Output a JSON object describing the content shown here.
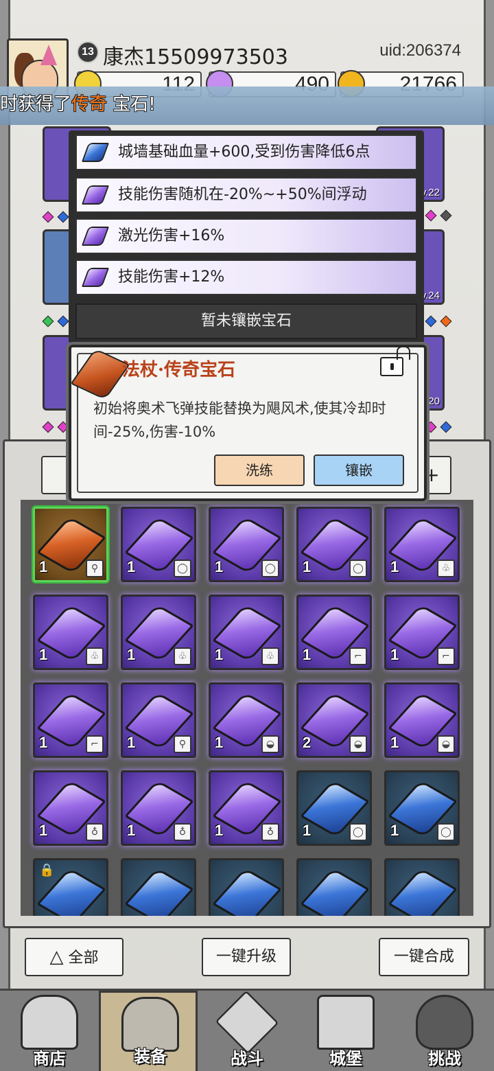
{
  "player": {
    "level": "13",
    "name": "康杰15509973503",
    "uid": "uid:206374"
  },
  "currencies": {
    "gold_bars": "112",
    "gems": "490",
    "coins": "21766"
  },
  "banner": {
    "prefix": "时获得了",
    "highlight": "传奇",
    "suffix": "宝石!"
  },
  "equip_slots": {
    "lv_a": "Lv.22",
    "lv_b": "Lv.24",
    "lv_c": "Lv.20"
  },
  "attributes": [
    {
      "text": "城墙基础血量+600,受到伤害降低6点",
      "gem": "blue"
    },
    {
      "text": "技能伤害随机在-20%~+50%间浮动",
      "gem": "purple"
    },
    {
      "text": "激光伤害+16%",
      "gem": "purple"
    },
    {
      "text": "技能伤害+12%",
      "gem": "purple"
    }
  ],
  "empty_socket": "暂未镶嵌宝石",
  "popup": {
    "title": "法杖·传奇宝石",
    "description": "初始将奥术飞弹技能替换为飓风术,使其冷却时间-25%,伤害-10%",
    "refine_button": "洗练",
    "inlay_button": "镶嵌"
  },
  "inventory": {
    "tab_right_label": "+",
    "rows": [
      [
        {
          "rarity": "legend",
          "qty": "1",
          "type": "staff"
        },
        {
          "rarity": "epic",
          "qty": "1",
          "type": "ring"
        },
        {
          "rarity": "epic",
          "qty": "1",
          "type": "ring"
        },
        {
          "rarity": "epic",
          "qty": "1",
          "type": "ring"
        },
        {
          "rarity": "epic",
          "qty": "1",
          "type": "armor"
        }
      ],
      [
        {
          "rarity": "epic",
          "qty": "1",
          "type": "armor"
        },
        {
          "rarity": "epic",
          "qty": "1",
          "type": "armor"
        },
        {
          "rarity": "epic",
          "qty": "1",
          "type": "armor"
        },
        {
          "rarity": "epic",
          "qty": "1",
          "type": "boots"
        },
        {
          "rarity": "epic",
          "qty": "1",
          "type": "boots"
        }
      ],
      [
        {
          "rarity": "epic",
          "qty": "1",
          "type": "boots"
        },
        {
          "rarity": "epic",
          "qty": "1",
          "type": "staff"
        },
        {
          "rarity": "epic",
          "qty": "1",
          "type": "hat"
        },
        {
          "rarity": "epic",
          "qty": "2",
          "type": "hat"
        },
        {
          "rarity": "epic",
          "qty": "1",
          "type": "hat"
        }
      ],
      [
        {
          "rarity": "epic",
          "qty": "1",
          "type": "necklace"
        },
        {
          "rarity": "epic",
          "qty": "1",
          "type": "necklace"
        },
        {
          "rarity": "epic",
          "qty": "1",
          "type": "necklace"
        },
        {
          "rarity": "rare",
          "qty": "1",
          "type": "ring"
        },
        {
          "rarity": "rare",
          "qty": "1",
          "type": "ring"
        }
      ],
      [
        {
          "rarity": "rare",
          "qty": "",
          "type": "",
          "locked": true
        },
        {
          "rarity": "rare",
          "qty": "",
          "type": ""
        },
        {
          "rarity": "rare",
          "qty": "",
          "type": ""
        },
        {
          "rarity": "rare",
          "qty": "",
          "type": ""
        },
        {
          "rarity": "rare",
          "qty": "",
          "type": ""
        }
      ]
    ]
  },
  "actions": {
    "filter_all": "全部",
    "upgrade_all": "一键升级",
    "merge_all": "一键合成"
  },
  "nav": [
    {
      "label": "商店",
      "icon": "shop-icon"
    },
    {
      "label": "装备",
      "icon": "backpack-icon"
    },
    {
      "label": "战斗",
      "icon": "crossed-swords-icon"
    },
    {
      "label": "城堡",
      "icon": "castle-icon"
    },
    {
      "label": "挑战",
      "icon": "challenge-icon"
    }
  ],
  "colors": {
    "epic": "#6a44c4",
    "rare": "#2a4256",
    "legend": "#d86226",
    "highlight": "#ff7a1a",
    "refine_button_bg": "#f7d6b3",
    "inlay_button_bg": "#a9d3f5"
  }
}
